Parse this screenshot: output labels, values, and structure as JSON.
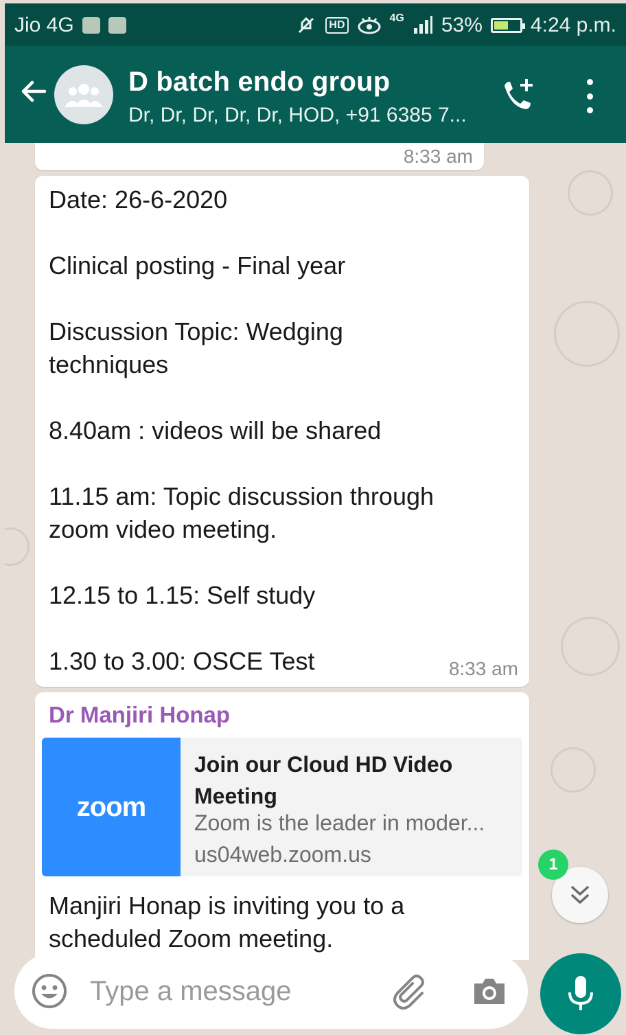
{
  "status_bar": {
    "carrier": "Jio 4G",
    "network": "4G",
    "battery": "53%",
    "time": "4:24 p.m.",
    "hd_label": "HD"
  },
  "header": {
    "title": "D batch endo group",
    "subtitle": "Dr, Dr, Dr, Dr, Dr, HOD, +91 6385 7..."
  },
  "messages": {
    "prev_time": "8:33 am",
    "main": {
      "lines": [
        "Date: 26-6-2020",
        "Clinical posting - Final year",
        "Discussion Topic: Wedging",
        "techniques",
        "8.40am : videos will be shared",
        "11.15 am: Topic discussion through",
        "zoom video meeting.",
        "12.15 to 1.15: Self study",
        "1.30 to 3.00: OSCE Test"
      ],
      "time": "8:33 am"
    },
    "zoom_message": {
      "sender": "Dr Manjiri Honap",
      "preview_logo": "zoom",
      "preview_title": "Join our Cloud HD Video Meeting",
      "preview_desc": "Zoom is the leader in moder...",
      "preview_url": "us04web.zoom.us",
      "body_lines": [
        "Manjiri Honap is inviting you to a",
        "scheduled Zoom meeting."
      ]
    }
  },
  "unread_count": "1",
  "input": {
    "placeholder": "Type a message"
  },
  "icons": {
    "back": "arrow-left-icon",
    "avatar": "group-icon",
    "call": "add-call-icon",
    "menu": "more-vert-icon",
    "emoji": "emoji-icon",
    "attach": "paperclip-icon",
    "camera": "camera-icon",
    "mic": "mic-icon",
    "scroll": "double-chevron-down-icon"
  },
  "colors": {
    "header": "#075e54",
    "status_bar": "#054d44",
    "accent": "#00897b",
    "unread": "#25d366",
    "sender": "#9b59b6",
    "zoom": "#2d8cff"
  }
}
